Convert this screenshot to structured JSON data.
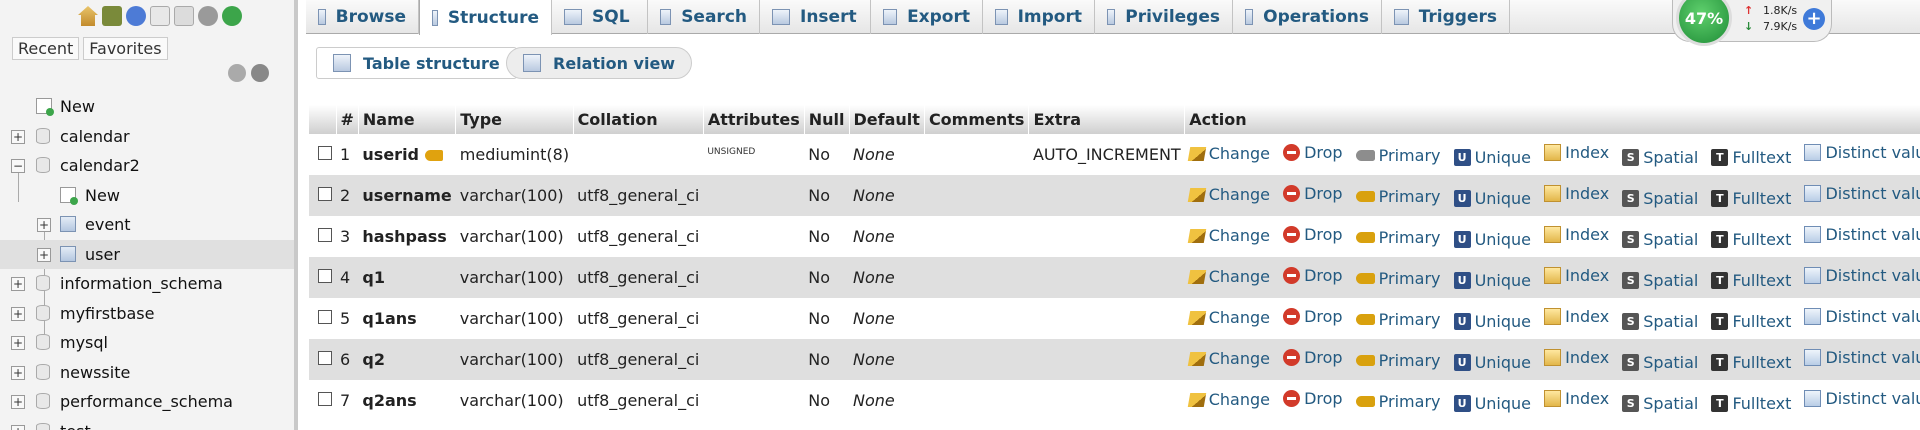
{
  "sidebar": {
    "recent_label": "Recent",
    "favorites_label": "Favorites",
    "tree": {
      "new": "New",
      "calendar": "calendar",
      "calendar2": "calendar2",
      "calendar2_new": "New",
      "event": "event",
      "user": "user",
      "information_schema": "information_schema",
      "myfirstbase": "myfirstbase",
      "mysql": "mysql",
      "newssite": "newssite",
      "performance_schema": "performance_schema",
      "test": "test"
    }
  },
  "tabs": [
    {
      "label": "Browse",
      "icon": "browse-icon"
    },
    {
      "label": "Structure",
      "icon": "structure-icon",
      "active": true
    },
    {
      "label": "SQL",
      "icon": "sql-icon"
    },
    {
      "label": "Search",
      "icon": "search-icon"
    },
    {
      "label": "Insert",
      "icon": "insert-icon"
    },
    {
      "label": "Export",
      "icon": "export-icon"
    },
    {
      "label": "Import",
      "icon": "import-icon"
    },
    {
      "label": "Privileges",
      "icon": "privileges-icon"
    },
    {
      "label": "Operations",
      "icon": "operations-icon"
    },
    {
      "label": "Triggers",
      "icon": "triggers-icon"
    }
  ],
  "monitor": {
    "percent": "47%",
    "up_rate": "1.8K/s",
    "down_rate": "7.9K/s"
  },
  "subnav": {
    "table_structure": "Table structure",
    "relation_view": "Relation view"
  },
  "table": {
    "headers": [
      "#",
      "Name",
      "Type",
      "Collation",
      "Attributes",
      "Null",
      "Default",
      "Comments",
      "Extra",
      "Action"
    ],
    "actions": [
      "Change",
      "Drop",
      "Primary",
      "Unique",
      "Index",
      "Spatial",
      "Fulltext",
      "Distinct values"
    ],
    "rows": [
      {
        "num": "1",
        "name": "userid",
        "type": "mediumint(8)",
        "collation": "",
        "attributes": "UNSIGNED",
        "null": "No",
        "default": "None",
        "comments": "",
        "extra": "AUTO_INCREMENT",
        "primary_key": true
      },
      {
        "num": "2",
        "name": "username",
        "type": "varchar(100)",
        "collation": "utf8_general_ci",
        "attributes": "",
        "null": "No",
        "default": "None",
        "comments": "",
        "extra": ""
      },
      {
        "num": "3",
        "name": "hashpass",
        "type": "varchar(100)",
        "collation": "utf8_general_ci",
        "attributes": "",
        "null": "No",
        "default": "None",
        "comments": "",
        "extra": ""
      },
      {
        "num": "4",
        "name": "q1",
        "type": "varchar(100)",
        "collation": "utf8_general_ci",
        "attributes": "",
        "null": "No",
        "default": "None",
        "comments": "",
        "extra": ""
      },
      {
        "num": "5",
        "name": "q1ans",
        "type": "varchar(100)",
        "collation": "utf8_general_ci",
        "attributes": "",
        "null": "No",
        "default": "None",
        "comments": "",
        "extra": ""
      },
      {
        "num": "6",
        "name": "q2",
        "type": "varchar(100)",
        "collation": "utf8_general_ci",
        "attributes": "",
        "null": "No",
        "default": "None",
        "comments": "",
        "extra": ""
      },
      {
        "num": "7",
        "name": "q2ans",
        "type": "varchar(100)",
        "collation": "utf8_general_ci",
        "attributes": "",
        "null": "No",
        "default": "None",
        "comments": "",
        "extra": ""
      }
    ]
  }
}
